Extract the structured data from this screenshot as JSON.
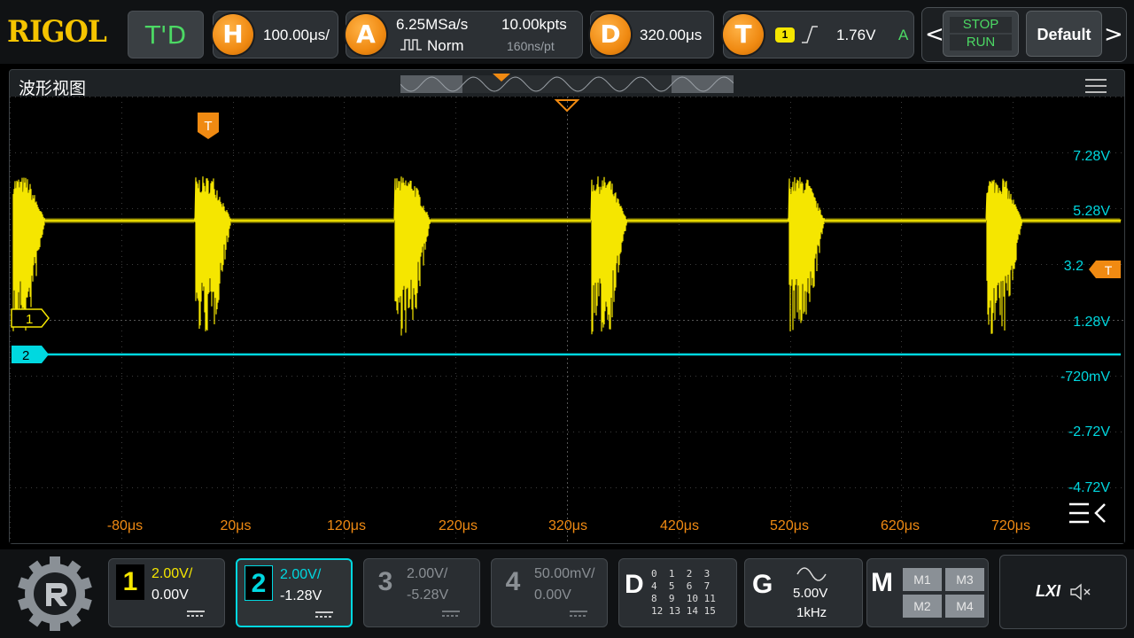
{
  "brand": "RIGOL",
  "topbar": {
    "td_label": "T'D",
    "horizontal": {
      "icon": "H",
      "value": "100.00μs/"
    },
    "acquire": {
      "icon": "A",
      "sample_rate": "6.25MSa/s",
      "mode": "Norm",
      "points": "10.00kpts",
      "interval": "160ns/pt"
    },
    "delay": {
      "icon": "D",
      "value": "320.00μs"
    },
    "trigger": {
      "icon": "T",
      "source": "1",
      "level": "1.76V",
      "mode": "A"
    },
    "stop_label": "STOP",
    "run_label": "RUN",
    "default_label": "Default",
    "nav_prev": "<",
    "nav_next": ">"
  },
  "window": {
    "title": "波形视图",
    "y_labels": [
      "7.28V",
      "5.28V",
      "3.2",
      "1.28V",
      "-720mV",
      "-2.72V",
      "-4.72V"
    ],
    "x_labels": [
      "-80μs",
      "20μs",
      "120μs",
      "220μs",
      "320μs",
      "420μs",
      "520μs",
      "620μs",
      "720μs"
    ],
    "trigger_marker": "T",
    "trigger_level_marker": "T",
    "ch1_marker": "1",
    "ch2_marker": "2"
  },
  "channels": [
    {
      "num": "1",
      "scale": "2.00V/",
      "offset": "0.00V",
      "color": "#f5e600",
      "active": true
    },
    {
      "num": "2",
      "scale": "2.00V/",
      "offset": "-1.28V",
      "color": "#00d8e0",
      "active": true,
      "selected": true
    },
    {
      "num": "3",
      "scale": "2.00V/",
      "offset": "-5.28V",
      "color": "#8a8f94",
      "active": false
    },
    {
      "num": "4",
      "scale": "50.00mV/",
      "offset": "0.00V",
      "color": "#8a8f94",
      "active": false
    }
  ],
  "digital": {
    "label": "D",
    "rows": [
      "0  1  2  3",
      "4  5  6  7",
      "8  9  10 11",
      "12 13 14 15"
    ]
  },
  "generator": {
    "label": "G",
    "amplitude": "5.00V",
    "frequency": "1kHz"
  },
  "math": {
    "label": "M",
    "items": [
      "M1",
      "M3",
      "M2",
      "M4"
    ]
  },
  "lxi_label": "LXI",
  "colors": {
    "ch1": "#f5e600",
    "ch2": "#00d8e0",
    "accent": "#f08a12",
    "scale_label": "#00d8e0",
    "time_label": "#f08a12"
  }
}
